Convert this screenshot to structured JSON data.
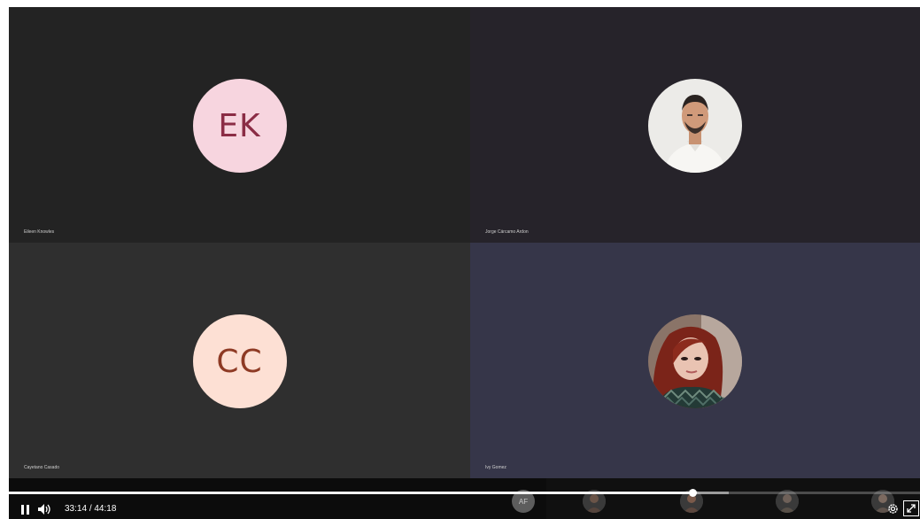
{
  "participants": [
    {
      "name": "Eileen Knowles",
      "initials": "EK",
      "avatar": "initials"
    },
    {
      "name": "Jorge Cárcamo Ardon",
      "avatar": "photo-man"
    },
    {
      "name": "Cayetano Casado",
      "initials": "CC",
      "avatar": "initials"
    },
    {
      "name": "Ivy Gomez",
      "avatar": "photo-woman"
    }
  ],
  "thumbnails": [
    {
      "initials": "AF"
    },
    {
      "icon": "person-photo-icon"
    },
    {
      "icon": "person-photo-icon"
    },
    {
      "icon": "person-photo-icon"
    },
    {
      "icon": "person-photo-icon"
    }
  ],
  "player": {
    "current_time": "33:14",
    "separator": "/",
    "duration": "44:18",
    "progress_fraction": 0.75,
    "buffered_fraction": 0.79,
    "icons": [
      "pause-icon",
      "volume-icon",
      "settings-icon",
      "fullscreen-icon"
    ]
  },
  "colors": {
    "ek_avatar_bg": "#f7d5df",
    "ek_avatar_text": "#8b2c45",
    "cc_avatar_bg": "#fde0d4",
    "cc_avatar_text": "#8e3a24"
  }
}
